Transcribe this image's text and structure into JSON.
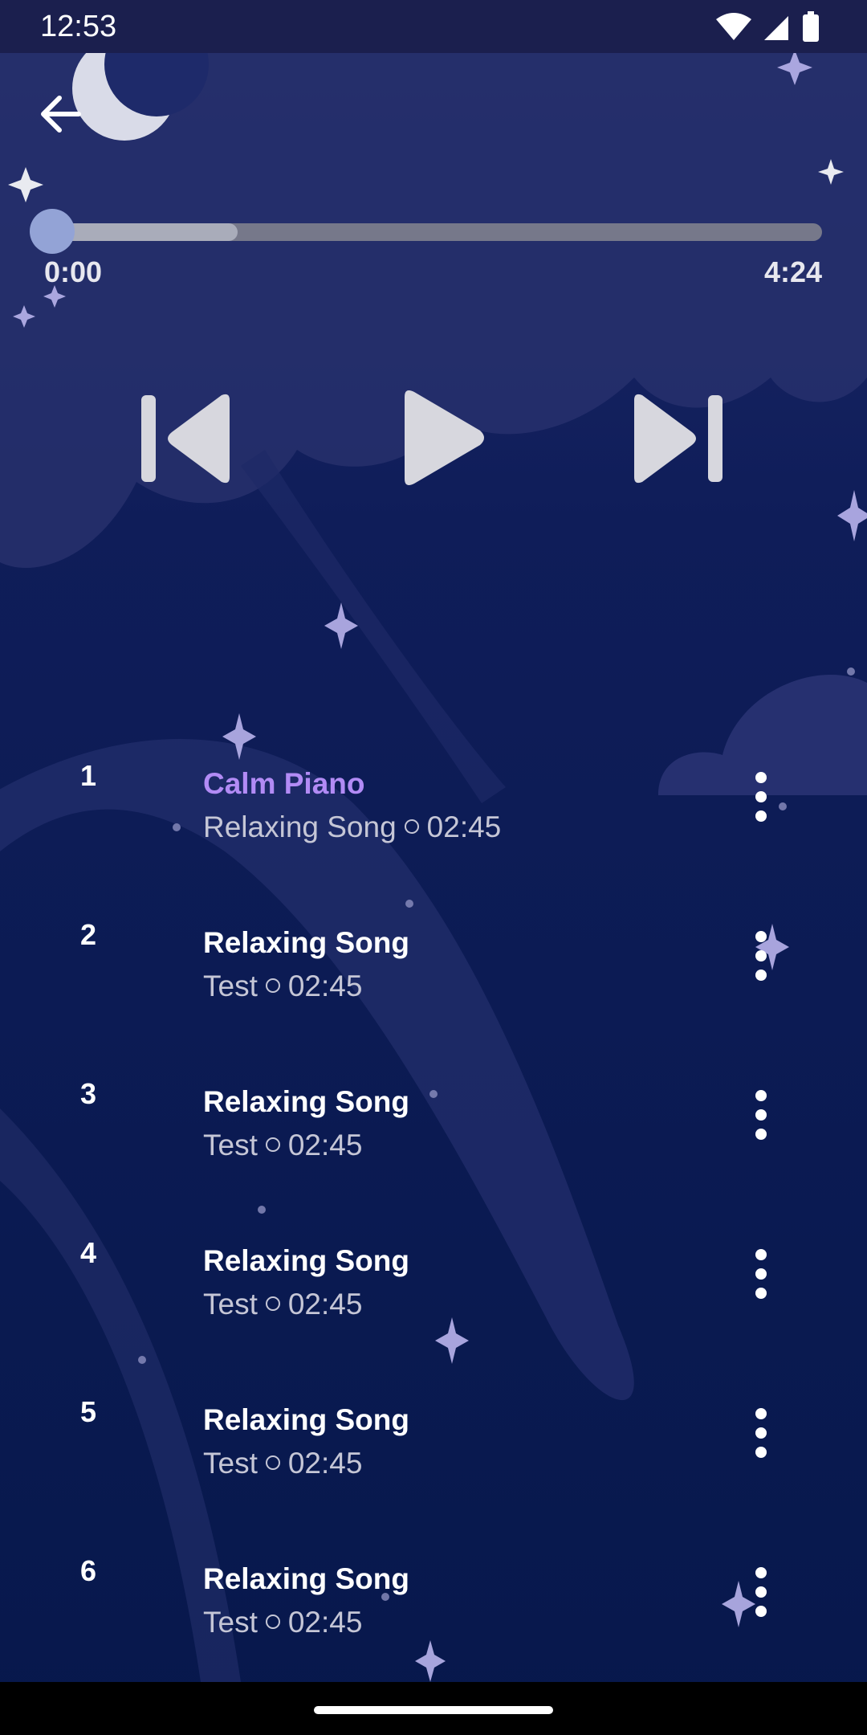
{
  "status_bar": {
    "time": "12:53",
    "icons": [
      "wifi-icon",
      "cell-signal-icon",
      "battery-icon"
    ]
  },
  "header": {
    "back_icon": "arrow-left-icon"
  },
  "player": {
    "current_time": "0:00",
    "total_time": "4:24",
    "progress_buffered_fraction": 0.24,
    "progress_played_fraction": 0.0,
    "controls": {
      "previous_icon": "skip-previous-icon",
      "play_icon": "play-icon",
      "next_icon": "skip-next-icon"
    }
  },
  "playlist": [
    {
      "number": "1",
      "title": "Calm Piano",
      "artist": "Relaxing Song",
      "duration": "02:45",
      "active": true
    },
    {
      "number": "2",
      "title": "Relaxing Song",
      "artist": "Test",
      "duration": "02:45",
      "active": false
    },
    {
      "number": "3",
      "title": "Relaxing Song",
      "artist": "Test",
      "duration": "02:45",
      "active": false
    },
    {
      "number": "4",
      "title": "Relaxing Song",
      "artist": "Test",
      "duration": "02:45",
      "active": false
    },
    {
      "number": "5",
      "title": "Relaxing Song",
      "artist": "Test",
      "duration": "02:45",
      "active": false
    },
    {
      "number": "6",
      "title": "Relaxing Song",
      "artist": "Test",
      "duration": "02:45",
      "active": false
    }
  ],
  "colors": {
    "background": "#0b1a4e",
    "accent_active_title": "#b28bf5",
    "progress_thumb": "#93a3d6",
    "status_bar": "#1b1f4e"
  }
}
